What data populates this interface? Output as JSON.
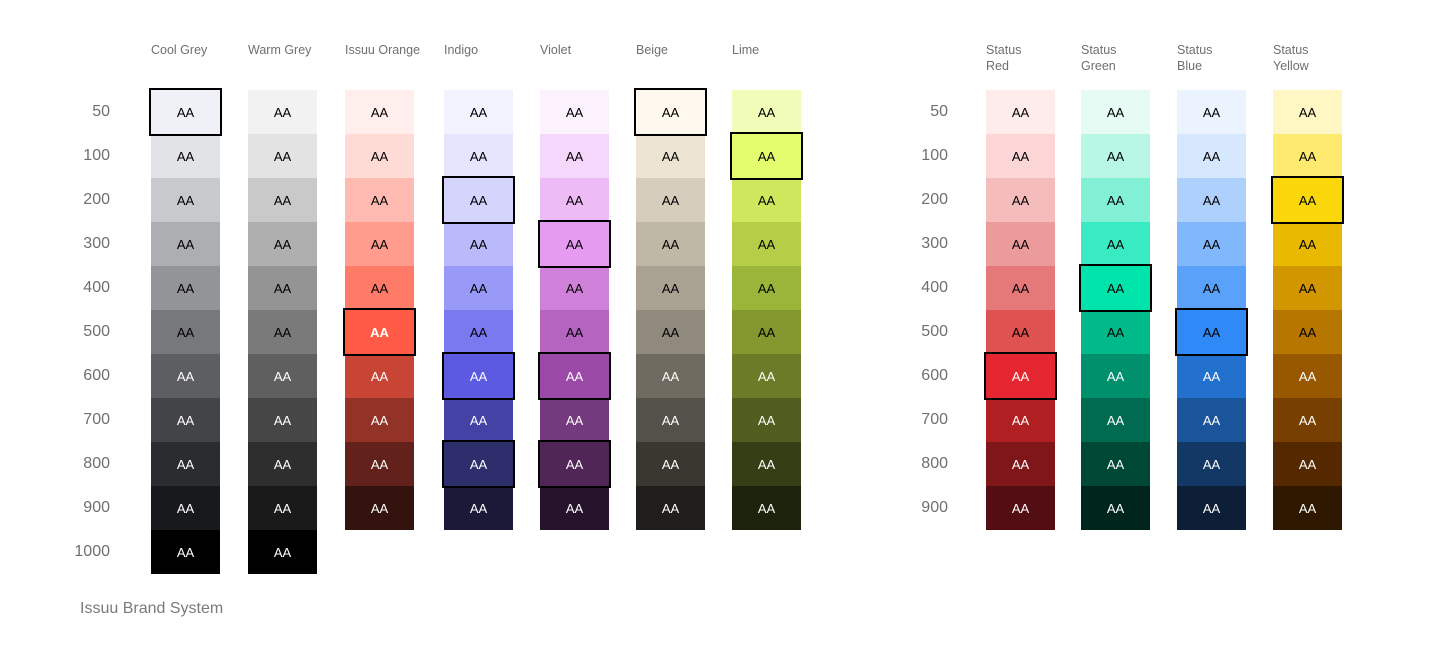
{
  "row_labels": [
    "50",
    "100",
    "200",
    "300",
    "400",
    "500",
    "600",
    "700",
    "800",
    "900",
    "1000"
  ],
  "caption": "Issuu Brand System",
  "groups": [
    {
      "columns": [
        {
          "name": "Cool Grey",
          "swatches": [
            {
              "label": "AA",
              "color": "#f0f1f6",
              "text": "#000000",
              "selected": true
            },
            {
              "label": "AA",
              "color": "#e2e3e6",
              "text": "#000000"
            },
            {
              "label": "AA",
              "color": "#c8c9cd",
              "text": "#000000"
            },
            {
              "label": "AA",
              "color": "#adaeb2",
              "text": "#000000"
            },
            {
              "label": "AA",
              "color": "#939497",
              "text": "#000000"
            },
            {
              "label": "AA",
              "color": "#77787c",
              "text": "#000000"
            },
            {
              "label": "AA",
              "color": "#5d5e62",
              "text": "#ffffff"
            },
            {
              "label": "AA",
              "color": "#434447",
              "text": "#ffffff"
            },
            {
              "label": "AA",
              "color": "#2b2c30",
              "text": "#ffffff"
            },
            {
              "label": "AA",
              "color": "#18191c",
              "text": "#ffffff"
            },
            {
              "label": "AA",
              "color": "#000000",
              "text": "#ffffff"
            }
          ]
        },
        {
          "name": "Warm Grey",
          "swatches": [
            {
              "label": "AA",
              "color": "#f2f2f2",
              "text": "#000000"
            },
            {
              "label": "AA",
              "color": "#e3e3e3",
              "text": "#000000"
            },
            {
              "label": "AA",
              "color": "#c9c9c9",
              "text": "#000000"
            },
            {
              "label": "AA",
              "color": "#afafaf",
              "text": "#000000"
            },
            {
              "label": "AA",
              "color": "#949494",
              "text": "#000000"
            },
            {
              "label": "AA",
              "color": "#7a7a7a",
              "text": "#000000"
            },
            {
              "label": "AA",
              "color": "#5f5f5f",
              "text": "#ffffff"
            },
            {
              "label": "AA",
              "color": "#464646",
              "text": "#ffffff"
            },
            {
              "label": "AA",
              "color": "#2e2e2e",
              "text": "#ffffff"
            },
            {
              "label": "AA",
              "color": "#1a1a1a",
              "text": "#ffffff"
            },
            {
              "label": "AA",
              "color": "#000000",
              "text": "#ffffff"
            }
          ]
        },
        {
          "name": "Issuu Orange",
          "swatches": [
            {
              "label": "AA",
              "color": "#ffeeec",
              "text": "#000000"
            },
            {
              "label": "AA",
              "color": "#ffdbd5",
              "text": "#000000"
            },
            {
              "label": "AA",
              "color": "#ffbbb1",
              "text": "#000000"
            },
            {
              "label": "AA",
              "color": "#ff9c8e",
              "text": "#000000"
            },
            {
              "label": "AA",
              "color": "#ff7a67",
              "text": "#000000"
            },
            {
              "label": "AA",
              "color": "#ff5a45",
              "text": "#ffffff",
              "selected": true,
              "bold": true
            },
            {
              "label": "AA",
              "color": "#c84536",
              "text": "#ffffff"
            },
            {
              "label": "AA",
              "color": "#933328",
              "text": "#ffffff"
            },
            {
              "label": "AA",
              "color": "#62211a",
              "text": "#ffffff"
            },
            {
              "label": "AA",
              "color": "#34120e",
              "text": "#ffffff"
            }
          ]
        },
        {
          "name": "Indigo",
          "swatches": [
            {
              "label": "AA",
              "color": "#f2f2ff",
              "text": "#000000"
            },
            {
              "label": "AA",
              "color": "#e4e4fd",
              "text": "#000000"
            },
            {
              "label": "AA",
              "color": "#d4d4fd",
              "text": "#000000",
              "selected": true
            },
            {
              "label": "AA",
              "color": "#b9b9fb",
              "text": "#000000"
            },
            {
              "label": "AA",
              "color": "#9999f7",
              "text": "#000000"
            },
            {
              "label": "AA",
              "color": "#7a79ef",
              "text": "#000000"
            },
            {
              "label": "AA",
              "color": "#5b5ae1",
              "text": "#ffffff",
              "selected": true
            },
            {
              "label": "AA",
              "color": "#4443a5",
              "text": "#ffffff"
            },
            {
              "label": "AA",
              "color": "#2f2e6c",
              "text": "#ffffff",
              "selected": true
            },
            {
              "label": "AA",
              "color": "#1a1a38",
              "text": "#ffffff"
            }
          ]
        },
        {
          "name": "Violet",
          "swatches": [
            {
              "label": "AA",
              "color": "#fbf2fe",
              "text": "#000000"
            },
            {
              "label": "AA",
              "color": "#f4d7fb",
              "text": "#000000"
            },
            {
              "label": "AA",
              "color": "#edbcf6",
              "text": "#000000"
            },
            {
              "label": "AA",
              "color": "#e59cf0",
              "text": "#000000",
              "selected": true
            },
            {
              "label": "AA",
              "color": "#cf80d8",
              "text": "#000000"
            },
            {
              "label": "AA",
              "color": "#b565c0",
              "text": "#000000"
            },
            {
              "label": "AA",
              "color": "#9a4aa6",
              "text": "#ffffff",
              "selected": true
            },
            {
              "label": "AA",
              "color": "#743a7e",
              "text": "#ffffff"
            },
            {
              "label": "AA",
              "color": "#4f2655",
              "text": "#ffffff",
              "selected": true
            },
            {
              "label": "AA",
              "color": "#26122b",
              "text": "#ffffff"
            }
          ]
        },
        {
          "name": "Beige",
          "swatches": [
            {
              "label": "AA",
              "color": "#fff8ee",
              "text": "#000000",
              "selected": true
            },
            {
              "label": "AA",
              "color": "#ede4d3",
              "text": "#000000"
            },
            {
              "label": "AA",
              "color": "#d6cdbc",
              "text": "#000000"
            },
            {
              "label": "AA",
              "color": "#c0b8a6",
              "text": "#000000"
            },
            {
              "label": "AA",
              "color": "#a9a292",
              "text": "#000000"
            },
            {
              "label": "AA",
              "color": "#8f8a7c",
              "text": "#000000"
            },
            {
              "label": "AA",
              "color": "#6f6b60",
              "text": "#ffffff"
            },
            {
              "label": "AA",
              "color": "#54514a",
              "text": "#ffffff"
            },
            {
              "label": "AA",
              "color": "#393730",
              "text": "#ffffff"
            },
            {
              "label": "AA",
              "color": "#1f1e1b",
              "text": "#ffffff"
            }
          ]
        },
        {
          "name": "Lime",
          "swatches": [
            {
              "label": "AA",
              "color": "#f1fcb8",
              "text": "#000000"
            },
            {
              "label": "AA",
              "color": "#e4fd6e",
              "text": "#000000",
              "selected": true
            },
            {
              "label": "AA",
              "color": "#cde85d",
              "text": "#000000"
            },
            {
              "label": "AA",
              "color": "#b4cf47",
              "text": "#000000"
            },
            {
              "label": "AA",
              "color": "#9bb43a",
              "text": "#000000"
            },
            {
              "label": "AA",
              "color": "#83982f",
              "text": "#000000"
            },
            {
              "label": "AA",
              "color": "#6a7c27",
              "text": "#ffffff"
            },
            {
              "label": "AA",
              "color": "#4f5e1e",
              "text": "#ffffff"
            },
            {
              "label": "AA",
              "color": "#353f15",
              "text": "#ffffff"
            },
            {
              "label": "AA",
              "color": "#1c220b",
              "text": "#ffffff"
            }
          ]
        }
      ]
    },
    {
      "columns": [
        {
          "name": "Status\nRed",
          "swatches": [
            {
              "label": "AA",
              "color": "#feecec",
              "text": "#000000"
            },
            {
              "label": "AA",
              "color": "#fcd6d6",
              "text": "#000000"
            },
            {
              "label": "AA",
              "color": "#f5bcbc",
              "text": "#000000"
            },
            {
              "label": "AA",
              "color": "#ec9b9b",
              "text": "#000000"
            },
            {
              "label": "AA",
              "color": "#e57878",
              "text": "#000000"
            },
            {
              "label": "AA",
              "color": "#df5252",
              "text": "#000000"
            },
            {
              "label": "AA",
              "color": "#e3262f",
              "text": "#ffffff",
              "selected": true
            },
            {
              "label": "AA",
              "color": "#b01f22",
              "text": "#ffffff"
            },
            {
              "label": "AA",
              "color": "#7e161a",
              "text": "#ffffff"
            },
            {
              "label": "AA",
              "color": "#520e12",
              "text": "#ffffff"
            }
          ]
        },
        {
          "name": "Status\nGreen",
          "swatches": [
            {
              "label": "AA",
              "color": "#e5fbf4",
              "text": "#000000"
            },
            {
              "label": "AA",
              "color": "#b9f7e5",
              "text": "#000000"
            },
            {
              "label": "AA",
              "color": "#82f0d4",
              "text": "#000000"
            },
            {
              "label": "AA",
              "color": "#38ebc3",
              "text": "#000000"
            },
            {
              "label": "AA",
              "color": "#00e4ac",
              "text": "#000000",
              "selected": true
            },
            {
              "label": "AA",
              "color": "#00ba8a",
              "text": "#000000"
            },
            {
              "label": "AA",
              "color": "#00916c",
              "text": "#ffffff"
            },
            {
              "label": "AA",
              "color": "#006b50",
              "text": "#ffffff"
            },
            {
              "label": "AA",
              "color": "#004836",
              "text": "#ffffff"
            },
            {
              "label": "AA",
              "color": "#00251c",
              "text": "#ffffff"
            }
          ]
        },
        {
          "name": "Status\nBlue",
          "swatches": [
            {
              "label": "AA",
              "color": "#ebf4fe",
              "text": "#000000"
            },
            {
              "label": "AA",
              "color": "#d6e8fe",
              "text": "#000000"
            },
            {
              "label": "AA",
              "color": "#add0fd",
              "text": "#000000"
            },
            {
              "label": "AA",
              "color": "#81b7fb",
              "text": "#000000"
            },
            {
              "label": "AA",
              "color": "#5aa2f9",
              "text": "#000000"
            },
            {
              "label": "AA",
              "color": "#2f8af7",
              "text": "#000000",
              "selected": true
            },
            {
              "label": "AA",
              "color": "#2371cf",
              "text": "#ffffff"
            },
            {
              "label": "AA",
              "color": "#1a559b",
              "text": "#ffffff"
            },
            {
              "label": "AA",
              "color": "#143865",
              "text": "#ffffff"
            },
            {
              "label": "AA",
              "color": "#0c1f36",
              "text": "#ffffff"
            }
          ]
        },
        {
          "name": "Status\nYellow",
          "swatches": [
            {
              "label": "AA",
              "color": "#fef7c3",
              "text": "#000000"
            },
            {
              "label": "AA",
              "color": "#feea6e",
              "text": "#000000"
            },
            {
              "label": "AA",
              "color": "#f9d70a",
              "text": "#000000",
              "selected": true
            },
            {
              "label": "AA",
              "color": "#e8b900",
              "text": "#000000"
            },
            {
              "label": "AA",
              "color": "#d29600",
              "text": "#000000"
            },
            {
              "label": "AA",
              "color": "#b77600",
              "text": "#000000"
            },
            {
              "label": "AA",
              "color": "#985800",
              "text": "#ffffff"
            },
            {
              "label": "AA",
              "color": "#774000",
              "text": "#ffffff"
            },
            {
              "label": "AA",
              "color": "#552900",
              "text": "#ffffff"
            },
            {
              "label": "AA",
              "color": "#2e1800",
              "text": "#ffffff"
            }
          ]
        }
      ]
    }
  ]
}
